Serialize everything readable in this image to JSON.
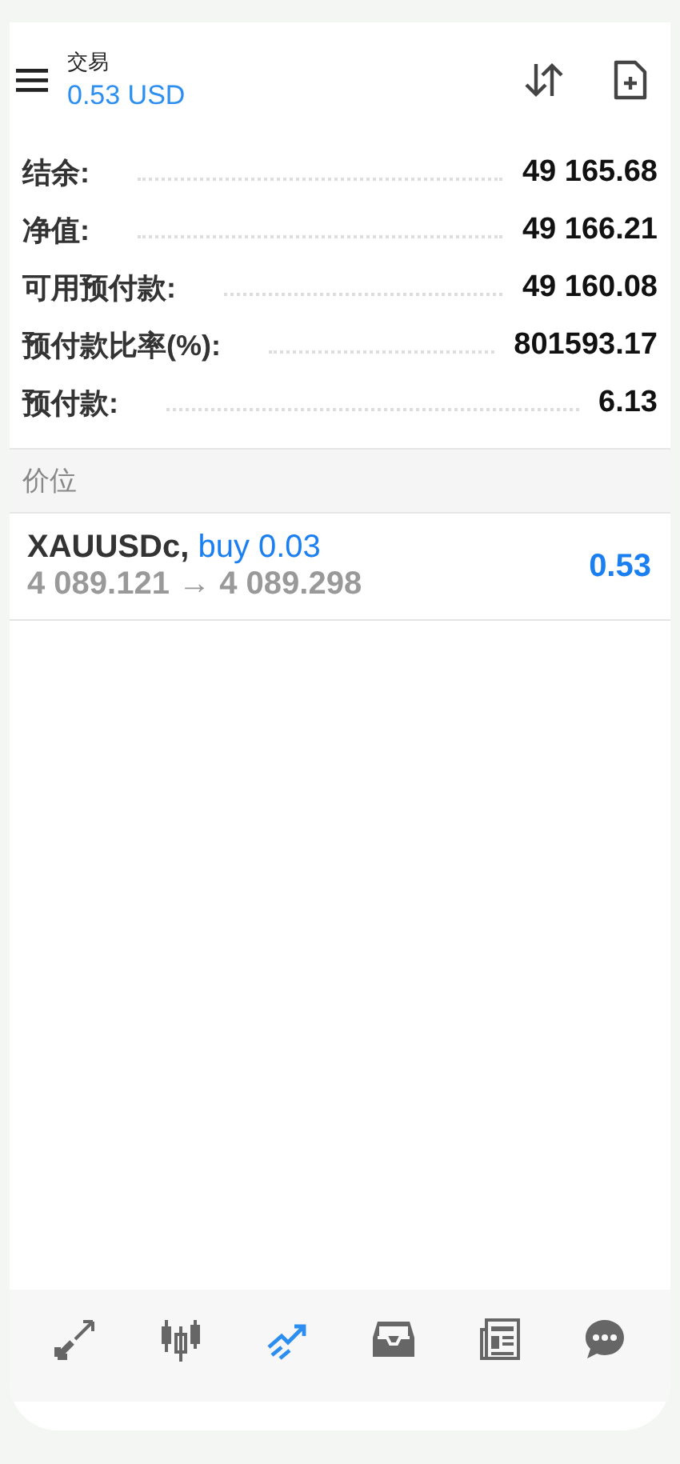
{
  "header": {
    "title": "交易",
    "profit": "0.53 USD"
  },
  "summary": [
    {
      "label": "结余:",
      "value": "49 165.68"
    },
    {
      "label": "净值:",
      "value": "49 166.21"
    },
    {
      "label": "可用预付款:",
      "value": "49 160.08"
    },
    {
      "label": "预付款比率(%):",
      "value": "801593.17"
    },
    {
      "label": "预付款:",
      "value": "6.13"
    }
  ],
  "section": {
    "title": "价位"
  },
  "positions": [
    {
      "symbol": "XAUUSDc,",
      "order": "buy 0.03",
      "prices": "4 089.121 → 4 089.298",
      "profit": "0.53"
    }
  ],
  "nav": [
    {
      "kind": "trade",
      "selected": false
    },
    {
      "kind": "candles",
      "selected": false
    },
    {
      "kind": "line",
      "selected": true
    },
    {
      "kind": "inbox",
      "selected": false
    },
    {
      "kind": "news",
      "selected": false
    },
    {
      "kind": "chat",
      "selected": false
    }
  ]
}
